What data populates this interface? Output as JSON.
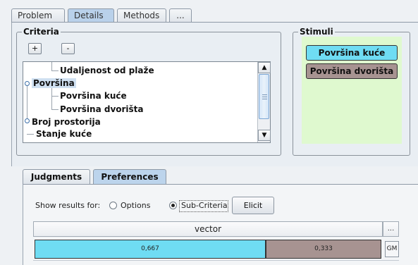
{
  "top_tabs": [
    "Problem",
    "Details",
    "Methods",
    "..."
  ],
  "top_tabs_active": 1,
  "criteria": {
    "title": "Criteria",
    "add_label": "+",
    "remove_label": "-",
    "tree": [
      {
        "label": "Udaljenost od plaže",
        "level": 1,
        "selected": false
      },
      {
        "label": "Površina",
        "level": 0,
        "selected": true
      },
      {
        "label": "Površina kuće",
        "level": 1,
        "selected": false
      },
      {
        "label": "Površina dvorišta",
        "level": 1,
        "selected": false
      },
      {
        "label": "Broj prostorija",
        "level": 0,
        "selected": false
      },
      {
        "label": "Stanje kuće",
        "level": 0,
        "selected": false
      }
    ],
    "scroll_up": "▲",
    "scroll_down": "▼"
  },
  "stimuli": {
    "title": "Stimuli",
    "items": [
      {
        "label": "Površina kuće",
        "color": "#6fdcf3"
      },
      {
        "label": "Površina dvorišta",
        "color": "#a79391"
      }
    ],
    "background": "#dff9cf"
  },
  "bottom_tabs": [
    "Judgments",
    "Preferences"
  ],
  "bottom_tabs_active": 1,
  "show_results": {
    "label": "Show results for:",
    "options": [
      {
        "label": "Options",
        "checked": false
      },
      {
        "label": "Sub-Criteria",
        "checked": true
      }
    ],
    "elicit_label": "Elicit"
  },
  "vector": {
    "header": "vector",
    "more": "...",
    "method": "GM",
    "values": [
      {
        "label": "0,667",
        "value": 0.667,
        "color": "#6fdcf3"
      },
      {
        "label": "0,333",
        "value": 0.333,
        "color": "#a79391"
      }
    ]
  }
}
